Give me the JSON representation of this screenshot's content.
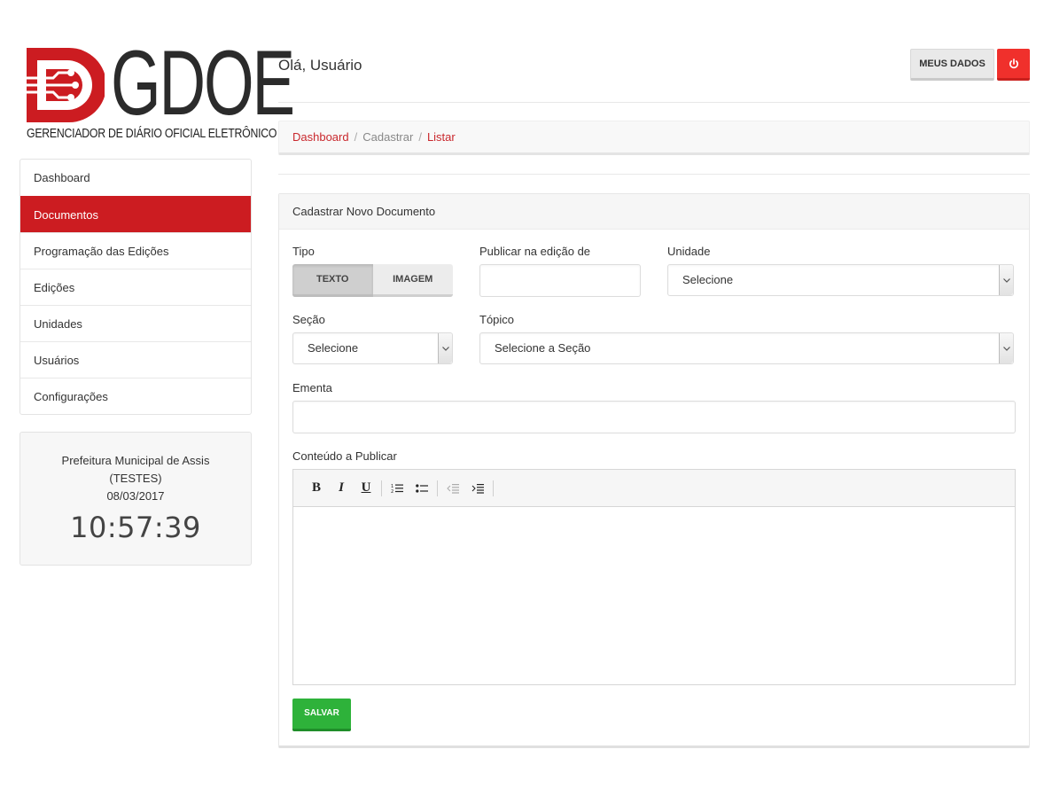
{
  "brand": {
    "name": "GDOE",
    "subtitle": "GERENCIADOR DE DIÁRIO OFICIAL ELETRÔNICO",
    "color": "#cc1c21"
  },
  "sidebar": {
    "items": [
      {
        "label": "Dashboard"
      },
      {
        "label": "Documentos",
        "active": true
      },
      {
        "label": "Programação das Edições"
      },
      {
        "label": "Edições"
      },
      {
        "label": "Unidades"
      },
      {
        "label": "Usuários"
      },
      {
        "label": "Configurações"
      }
    ]
  },
  "clock": {
    "organization": "Prefeitura Municipal de Assis (TESTES)",
    "date": "08/03/2017",
    "time": "10:57:39"
  },
  "header": {
    "greeting": "Olá, Usuário",
    "my_data_label": "MEUS DADOS",
    "power_icon": "power-icon",
    "power_color": "#f0302c"
  },
  "breadcrumb": {
    "items": [
      "Dashboard",
      "Cadastrar",
      "Listar"
    ],
    "separator": "/"
  },
  "form": {
    "title": "Cadastrar Novo Documento",
    "tipo": {
      "label": "Tipo",
      "options": [
        "TEXTO",
        "IMAGEM"
      ],
      "selected": "TEXTO"
    },
    "edicao": {
      "label": "Publicar na edição de",
      "value": ""
    },
    "unidade": {
      "label": "Unidade",
      "value": "Selecione"
    },
    "secao": {
      "label": "Seção",
      "value": "Selecione"
    },
    "topico": {
      "label": "Tópico",
      "value": "Selecione a Seção"
    },
    "ementa": {
      "label": "Ementa",
      "value": ""
    },
    "conteudo": {
      "label": "Conteúdo a Publicar",
      "toolbar": [
        "bold",
        "italic",
        "underline",
        "ordered-list",
        "unordered-list",
        "outdent",
        "indent"
      ]
    },
    "save_label": "SALVAR",
    "save_color": "#2eb23a"
  }
}
